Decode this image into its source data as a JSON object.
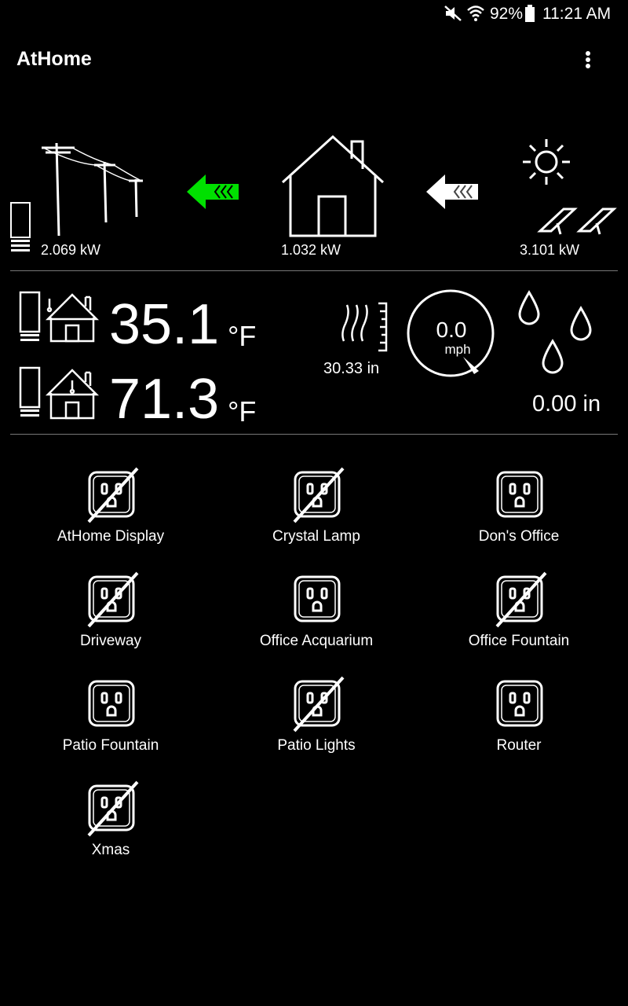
{
  "status_bar": {
    "battery": "92%",
    "time": "11:21 AM",
    "icons": [
      "mute-icon",
      "wifi-icon",
      "battery-icon"
    ]
  },
  "app_bar": {
    "title": "AtHome",
    "menu_icon": "more-vert-icon"
  },
  "energy": {
    "grid_kw": "2.069 kW",
    "home_kw": "1.032 kW",
    "solar_kw": "3.101 kW",
    "grid_arrow_color": "#00e000",
    "solar_arrow_color": "#ffffff"
  },
  "weather": {
    "outdoor_temp": "35.1",
    "indoor_temp": "71.3",
    "temp_unit": "°F",
    "pressure": "30.33 in",
    "wind_speed": "0.0",
    "wind_unit": "mph",
    "rainfall": "0.00 in"
  },
  "outlets": [
    {
      "name": "AtHome Display",
      "off": true
    },
    {
      "name": "Crystal Lamp",
      "off": true
    },
    {
      "name": "Don's Office",
      "off": false
    },
    {
      "name": "Driveway",
      "off": true
    },
    {
      "name": "Office Acquarium",
      "off": false
    },
    {
      "name": "Office Fountain",
      "off": true
    },
    {
      "name": "Patio Fountain",
      "off": false
    },
    {
      "name": "Patio Lights",
      "off": true
    },
    {
      "name": "Router",
      "off": false
    },
    {
      "name": "Xmas",
      "off": true
    }
  ]
}
